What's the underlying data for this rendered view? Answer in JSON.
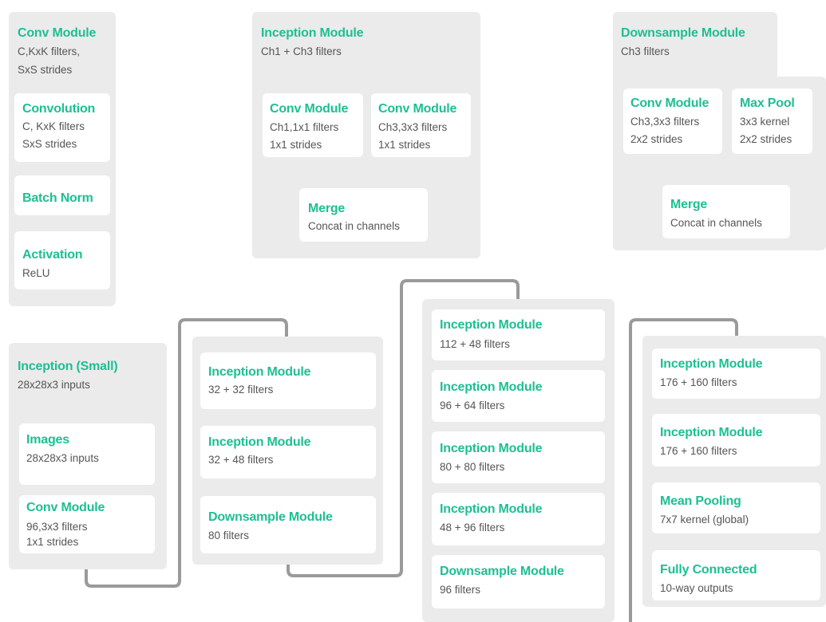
{
  "colors": {
    "title": "#1dbf93",
    "panel": "#ebebeb",
    "connector": "#9a9a9a"
  },
  "conv_def": {
    "title": "Conv Module",
    "l1": "C,KxK filters,",
    "l2": "SxS strides",
    "convolution": {
      "title": "Convolution",
      "l1": "C, KxK filters",
      "l2": "SxS strides"
    },
    "batchnorm": {
      "title": "Batch Norm"
    },
    "activation": {
      "title": "Activation",
      "l1": "ReLU"
    }
  },
  "incep_def": {
    "title": "Inception Module",
    "l1": "Ch1 + Ch3 filters",
    "conv1": {
      "title": "Conv Module",
      "l1": "Ch1,1x1 filters",
      "l2": "1x1 strides"
    },
    "conv3": {
      "title": "Conv Module",
      "l1": "Ch3,3x3 filters",
      "l2": "1x1 strides"
    },
    "merge": {
      "title": "Merge",
      "l1": "Concat in channels"
    }
  },
  "down_def": {
    "title": "Downsample Module",
    "l1": "Ch3 filters",
    "conv": {
      "title": "Conv Module",
      "l1": "Ch3,3x3 filters",
      "l2": "2x2 strides"
    },
    "pool": {
      "title": "Max Pool",
      "l1": "3x3 kernel",
      "l2": "2x2 strides"
    },
    "merge": {
      "title": "Merge",
      "l1": "Concat in channels"
    }
  },
  "net": {
    "title": "Inception (Small)",
    "l1": "28x28x3 inputs",
    "images": {
      "title": "Images",
      "l1": "28x28x3 inputs"
    },
    "conv": {
      "title": "Conv Module",
      "l1": "96,3x3 filters",
      "l2": "1x1 strides"
    }
  },
  "col2": [
    {
      "title": "Inception Module",
      "l1": "32 + 32 filters"
    },
    {
      "title": "Inception Module",
      "l1": "32 + 48 filters"
    },
    {
      "title": "Downsample Module",
      "l1": "80 filters"
    }
  ],
  "col3": [
    {
      "title": "Inception Module",
      "l1": "112 + 48 filters"
    },
    {
      "title": "Inception Module",
      "l1": "96 + 64 filters"
    },
    {
      "title": "Inception Module",
      "l1": "80 + 80 filters"
    },
    {
      "title": "Inception Module",
      "l1": "48 + 96 filters"
    },
    {
      "title": "Downsample Module",
      "l1": "96 filters"
    }
  ],
  "col4": [
    {
      "title": "Inception Module",
      "l1": "176 + 160 filters"
    },
    {
      "title": "Inception Module",
      "l1": "176 + 160 filters"
    },
    {
      "title": "Mean Pooling",
      "l1": "7x7 kernel (global)"
    },
    {
      "title": "Fully Connected",
      "l1": "10-way outputs"
    }
  ]
}
